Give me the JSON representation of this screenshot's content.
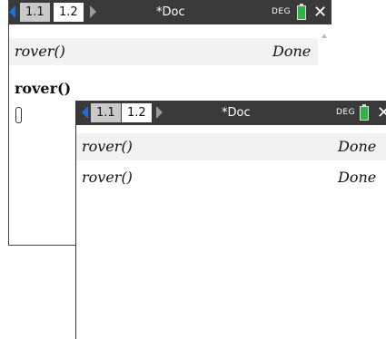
{
  "back_window": {
    "tabs": [
      {
        "label": "1.1"
      },
      {
        "label": "1.2"
      }
    ],
    "doc_title": "*Doc",
    "angle_mode": "DEG",
    "history": [
      {
        "expression": "rover()",
        "result": "Done"
      }
    ],
    "entry": "rover()"
  },
  "front_window": {
    "tabs": [
      {
        "label": "1.1"
      },
      {
        "label": "1.2"
      }
    ],
    "doc_title": "*Doc",
    "angle_mode": "DEG",
    "history": [
      {
        "expression": "rover()",
        "result": "Done"
      },
      {
        "expression": "rover()",
        "result": "Done"
      }
    ]
  },
  "colors": {
    "tabbar": "#3a3a3a",
    "tab_active": "#ffffff",
    "tab_inactive": "#c9c9c9",
    "arrow_left": "#1e6fd9",
    "battery": "#2fb344"
  }
}
